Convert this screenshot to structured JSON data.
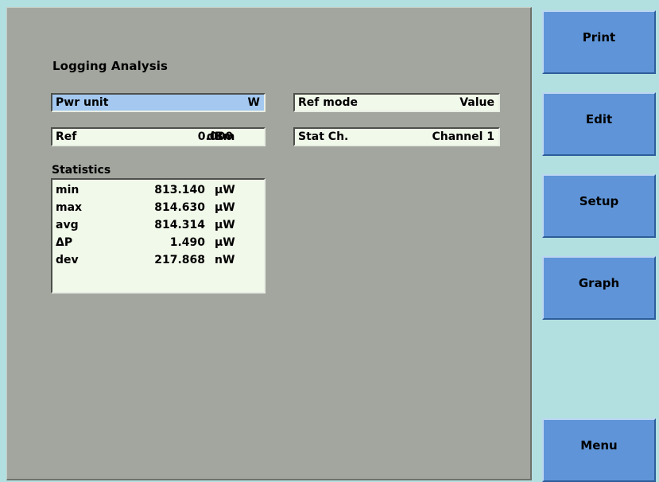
{
  "title": "Logging Analysis",
  "pwr_unit": {
    "label": "Pwr unit",
    "value": "W"
  },
  "ref_mode": {
    "label": "Ref mode",
    "value": "Value"
  },
  "ref": {
    "label": "Ref",
    "value": "0.000",
    "unit": "dBm"
  },
  "stat_ch": {
    "label": "Stat Ch.",
    "value": "Channel 1"
  },
  "statistics": {
    "label": "Statistics",
    "rows": [
      {
        "name": "min",
        "value": "813.140",
        "unit": "µW"
      },
      {
        "name": "max",
        "value": "814.630",
        "unit": "µW"
      },
      {
        "name": "avg",
        "value": "814.314",
        "unit": "µW"
      },
      {
        "name": "ΔP",
        "value": "1.490",
        "unit": "µW"
      },
      {
        "name": "dev",
        "value": "217.868",
        "unit": "nW"
      }
    ]
  },
  "sidebar": {
    "print": "Print",
    "edit": "Edit",
    "setup": "Setup",
    "graph": "Graph",
    "menu": "Menu"
  },
  "colors": {
    "background": "#b2dfe0",
    "panel": "#a3a69f",
    "field": "#f1f9ea",
    "selected_field": "#a4c8f0",
    "button": "#5f95d8"
  }
}
